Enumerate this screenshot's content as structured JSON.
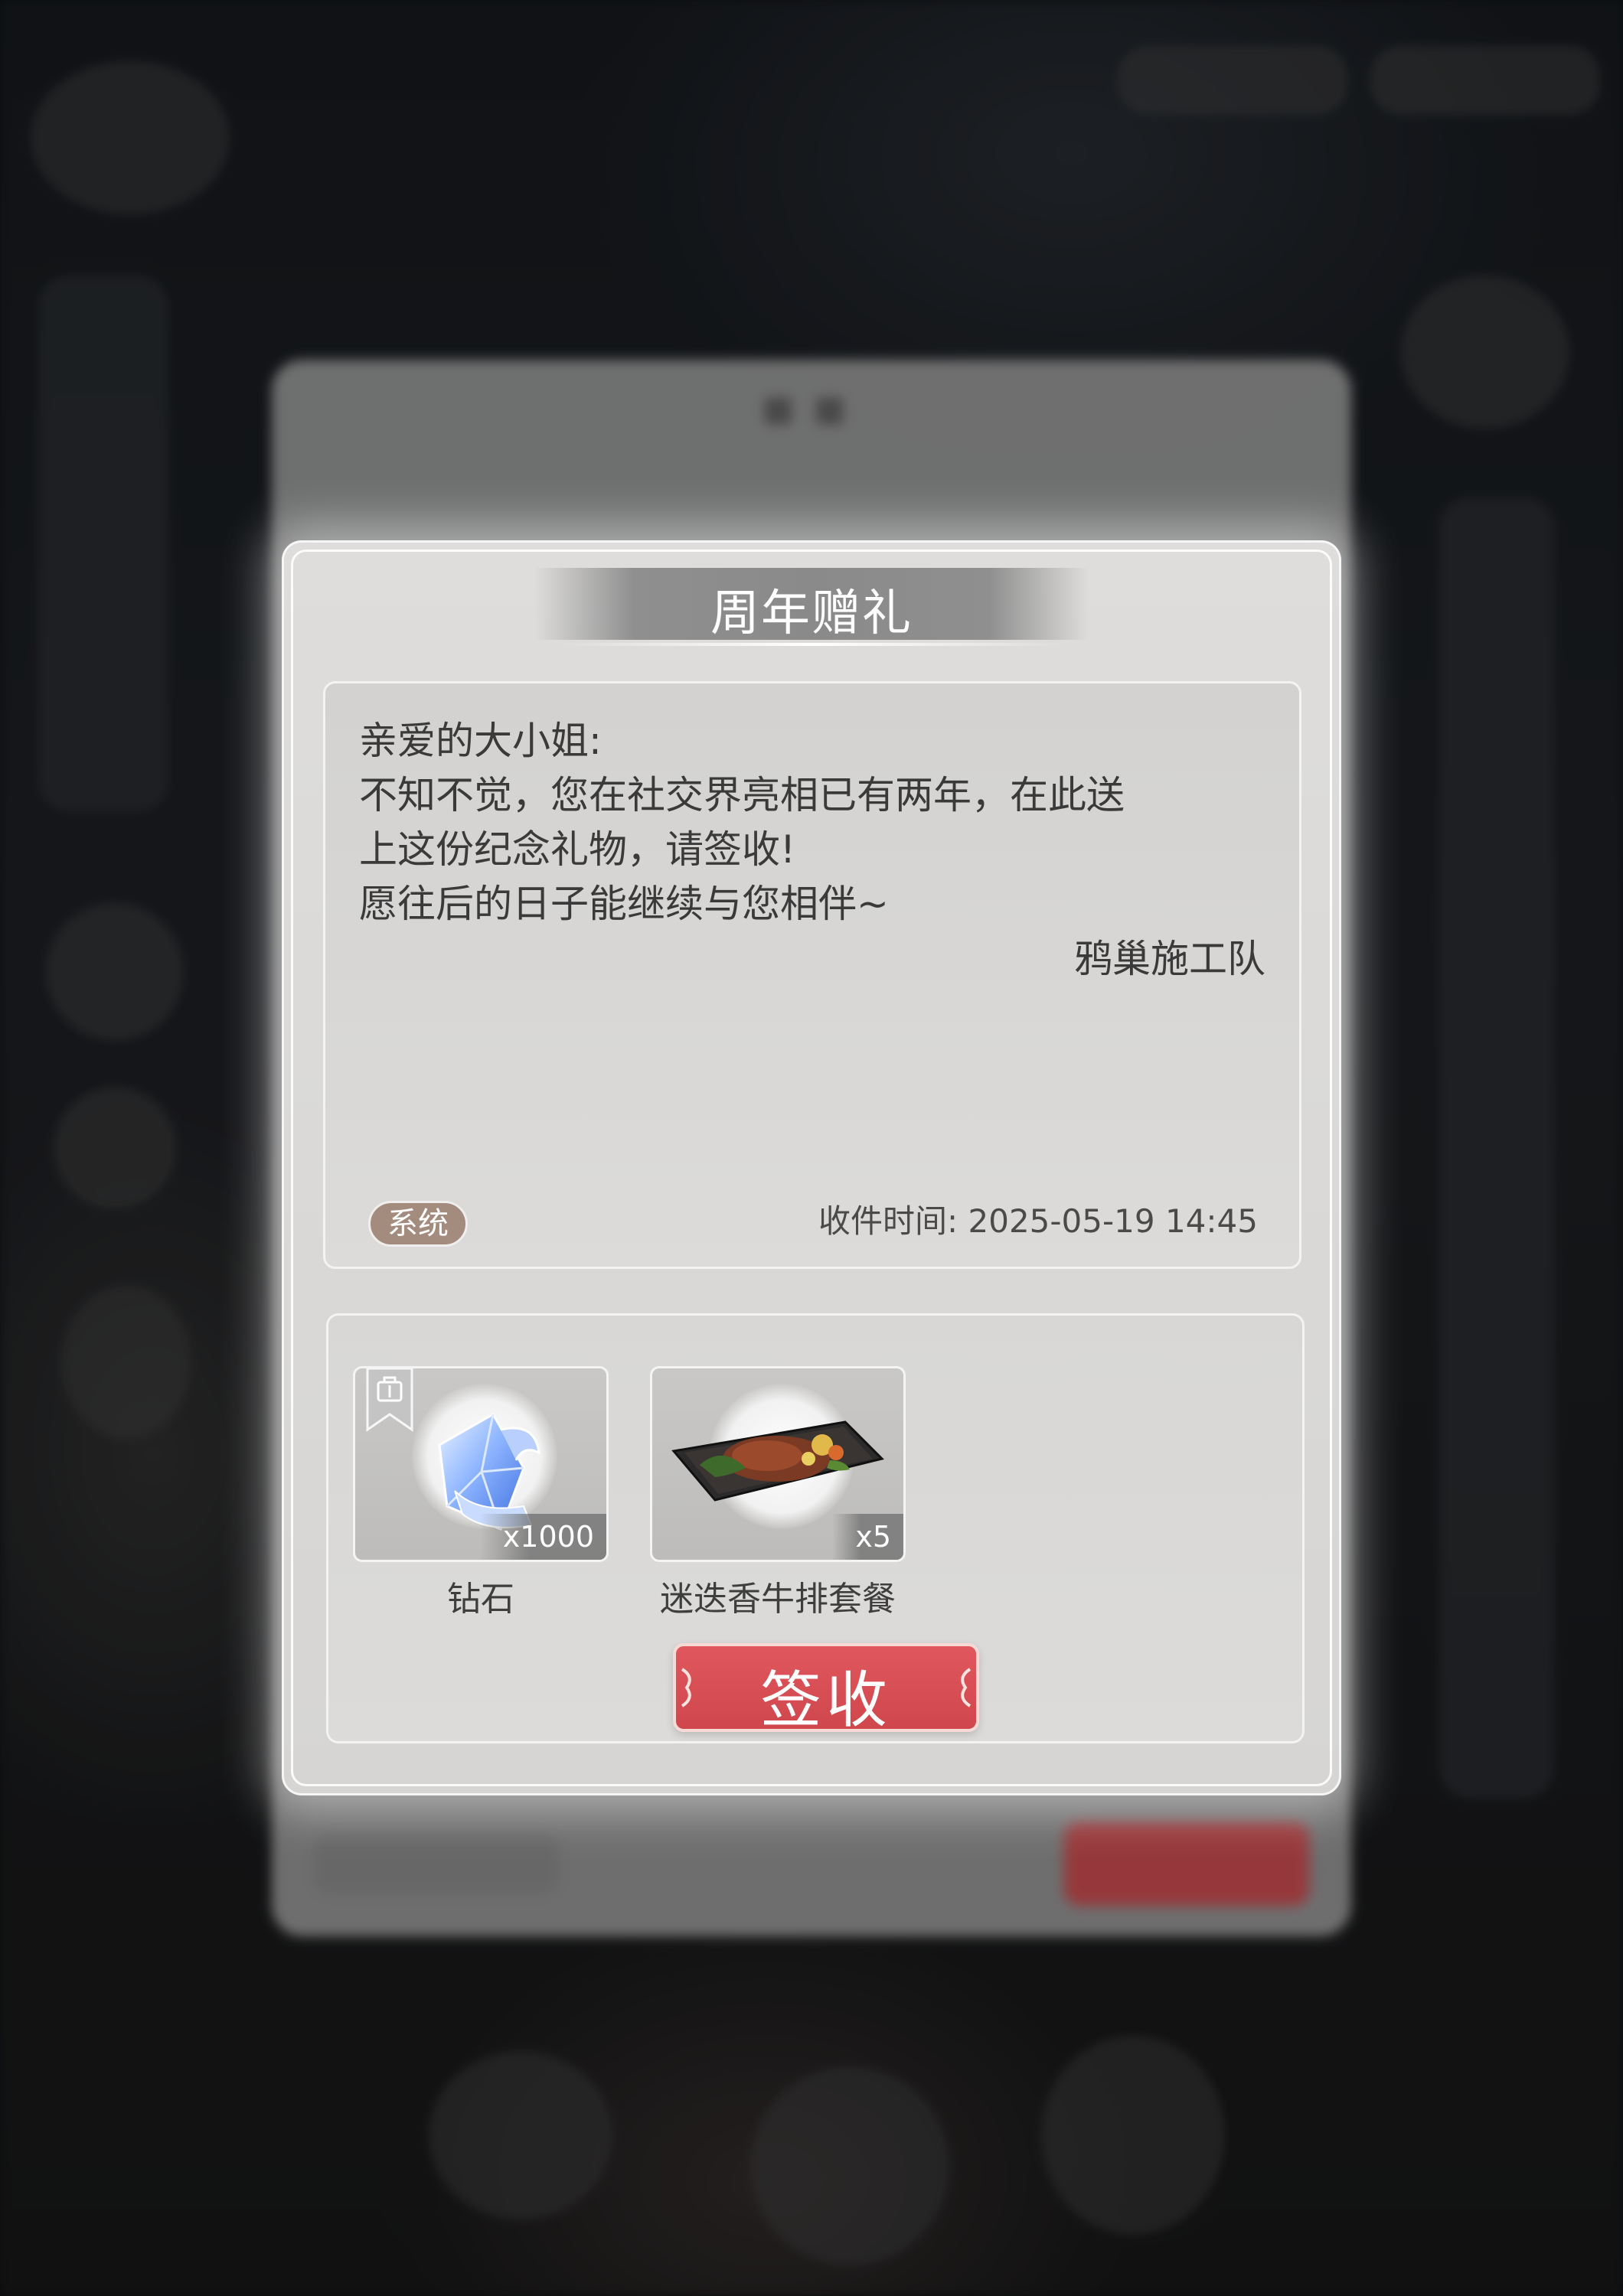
{
  "dialog": {
    "title": "周年赠礼",
    "message_lines": [
      "亲爱的大小姐:",
      "不知不觉，您在社交界亮相已有两年，在此送",
      "上这份纪念礼物，请签收!",
      "愿往后的日子能继续与您相伴~"
    ],
    "signature": "鸦巢施工队",
    "tag": "系统",
    "received_time": "收件时间: 2025-05-19 14:45"
  },
  "rewards": [
    {
      "name": "钻石",
      "count": "x1000",
      "icon": "diamond-ticket-icon"
    },
    {
      "name": "迷迭香牛排套餐",
      "count": "x5",
      "icon": "steak-platter-icon"
    }
  ],
  "sign_button": {
    "label": "签收"
  },
  "colors": {
    "accent_red": "#d64e53",
    "tag_brown": "#a38c7e",
    "panel_grey": "#d8d7d5"
  }
}
